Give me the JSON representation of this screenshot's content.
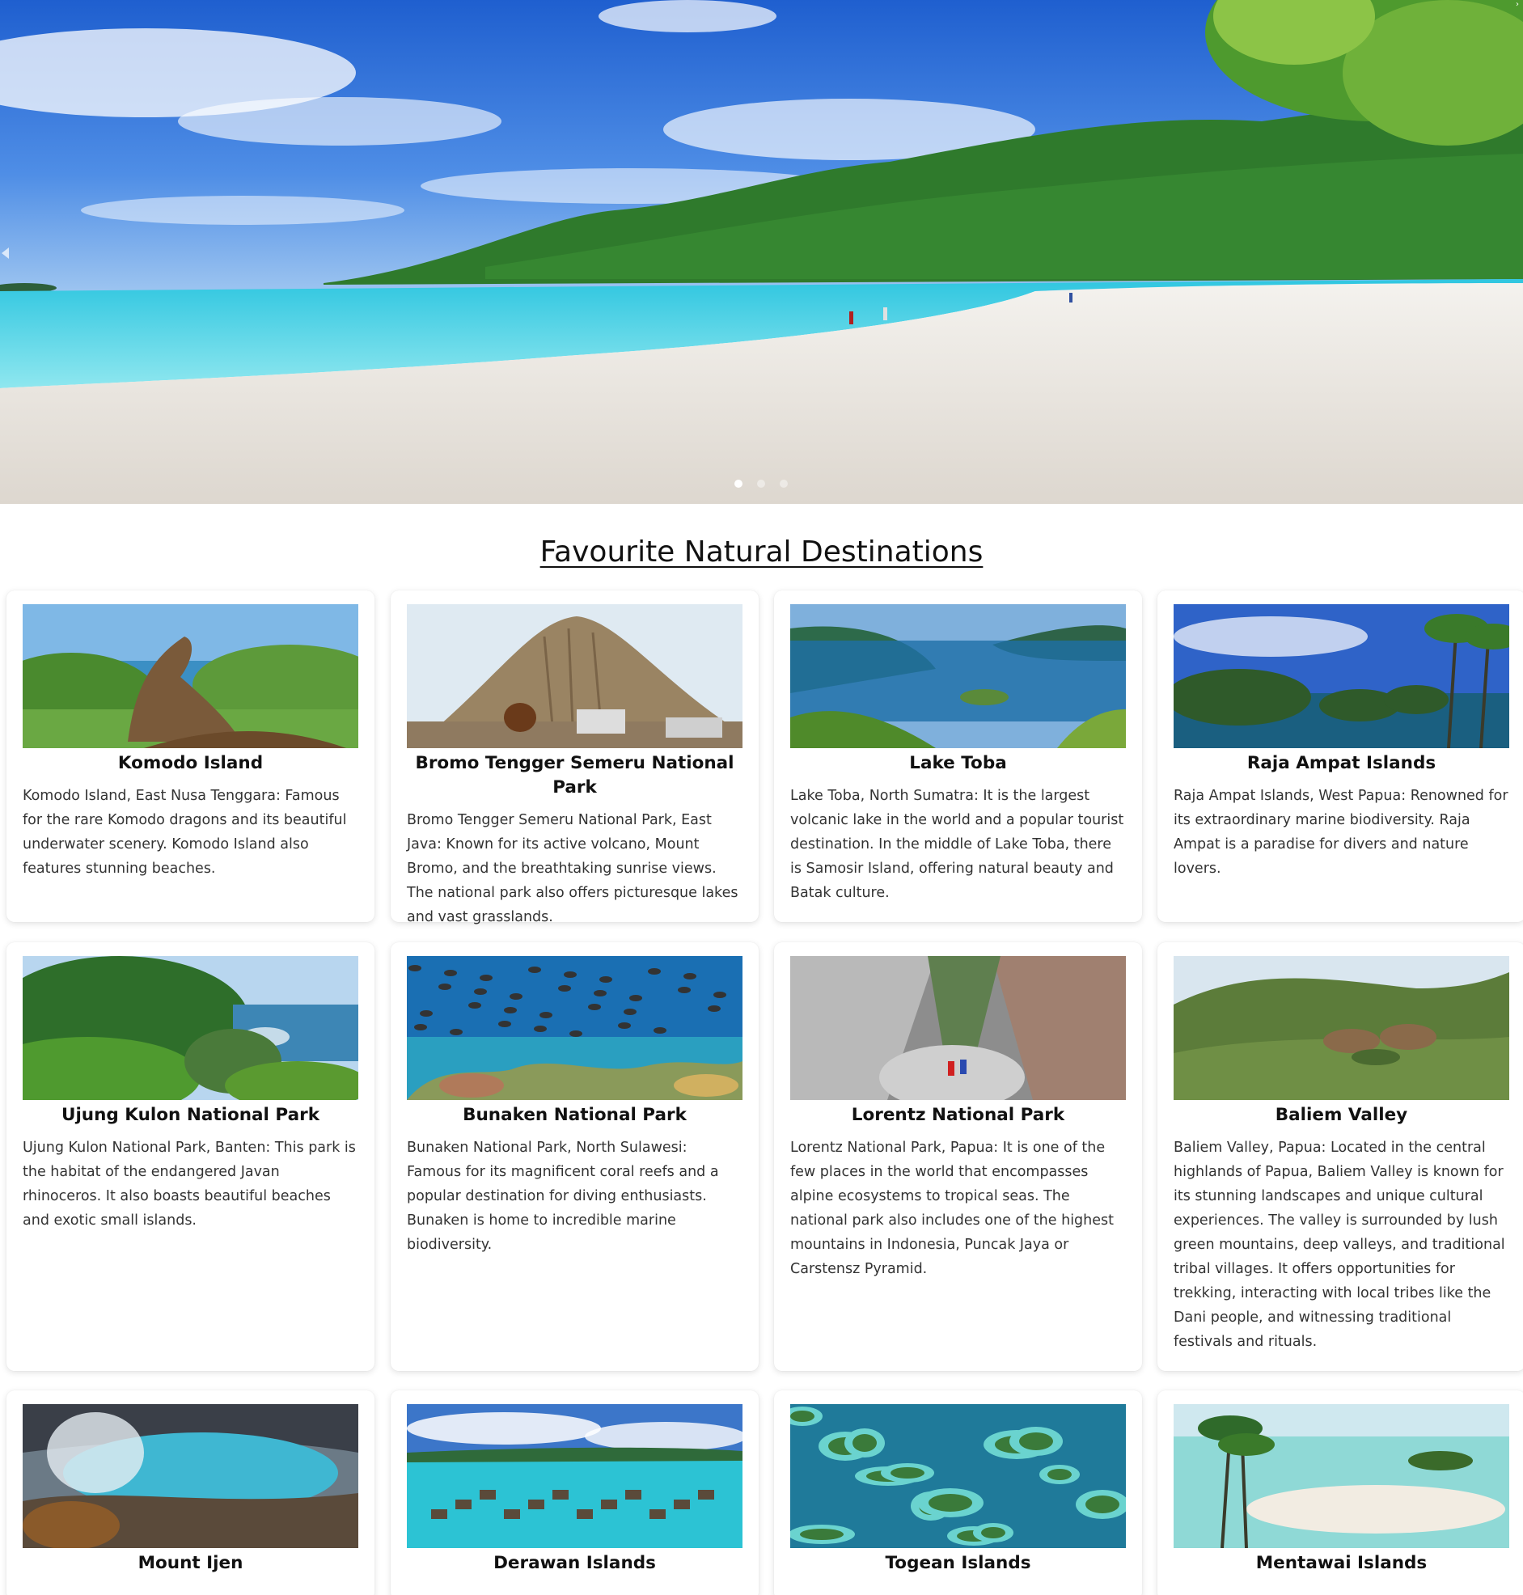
{
  "hero": {
    "next_glyph": "›",
    "slide_count": 3,
    "active_slide": 1
  },
  "section": {
    "title": "Favourite Natural Destinations"
  },
  "destinations": [
    {
      "title": "Komodo Island",
      "description": "Komodo Island, East Nusa Tenggara: Famous for the rare Komodo dragons and its beautiful underwater scenery. Komodo Island also features stunning beaches.",
      "image_subject": "komodo-dragon"
    },
    {
      "title": "Bromo Tengger Semeru National Park",
      "description": "Bromo Tengger Semeru National Park, East Java: Known for its active volcano, Mount Bromo, and the breathtaking sunrise views. The national park also offers picturesque lakes and vast grasslands.",
      "image_subject": "volcano"
    },
    {
      "title": "Lake Toba",
      "description": "Lake Toba, North Sumatra: It is the largest volcanic lake in the world and a popular tourist destination. In the middle of Lake Toba, there is Samosir Island, offering natural beauty and Batak culture.",
      "image_subject": "lake"
    },
    {
      "title": "Raja Ampat Islands",
      "description": "Raja Ampat Islands, West Papua: Renowned for its extraordinary marine biodiversity. Raja Ampat is a paradise for divers and nature lovers.",
      "image_subject": "islands"
    },
    {
      "title": "Ujung Kulon National Park",
      "description": "Ujung Kulon National Park, Banten: This park is the habitat of the endangered Javan rhinoceros. It also boasts beautiful beaches and exotic small islands.",
      "image_subject": "jungle-coast"
    },
    {
      "title": "Bunaken National Park",
      "description": "Bunaken National Park, North Sulawesi: Famous for its magnificent coral reefs and a popular destination for diving enthusiasts. Bunaken is home to incredible marine biodiversity.",
      "image_subject": "coral-reef"
    },
    {
      "title": "Lorentz National Park",
      "description": "Lorentz National Park, Papua: It is one of the few places in the world that encompasses alpine ecosystems to tropical seas. The national park also includes one of the highest mountains in Indonesia, Puncak Jaya or Carstensz Pyramid.",
      "image_subject": "rocky-mountains"
    },
    {
      "title": "Baliem Valley",
      "description": "Baliem Valley, Papua: Located in the central highlands of Papua, Baliem Valley is known for its stunning landscapes and unique cultural experiences. The valley is surrounded by lush green mountains, deep valleys, and traditional tribal villages. It offers opportunities for trekking, interacting with local tribes like the Dani people, and witnessing traditional festivals and rituals.",
      "image_subject": "valley-huts"
    },
    {
      "title": "Mount Ijen",
      "description": "",
      "image_subject": "crater-lake"
    },
    {
      "title": "Derawan Islands",
      "description": "",
      "image_subject": "water-villas"
    },
    {
      "title": "Togean Islands",
      "description": "",
      "image_subject": "atolls"
    },
    {
      "title": "Mentawai Islands",
      "description": "",
      "image_subject": "palm-shallows"
    }
  ],
  "colors": {
    "sky_top": "#2f6fd6",
    "sea": "#3fd0e6",
    "sand": "#ece8e2",
    "forest": "#2f7a2c"
  }
}
